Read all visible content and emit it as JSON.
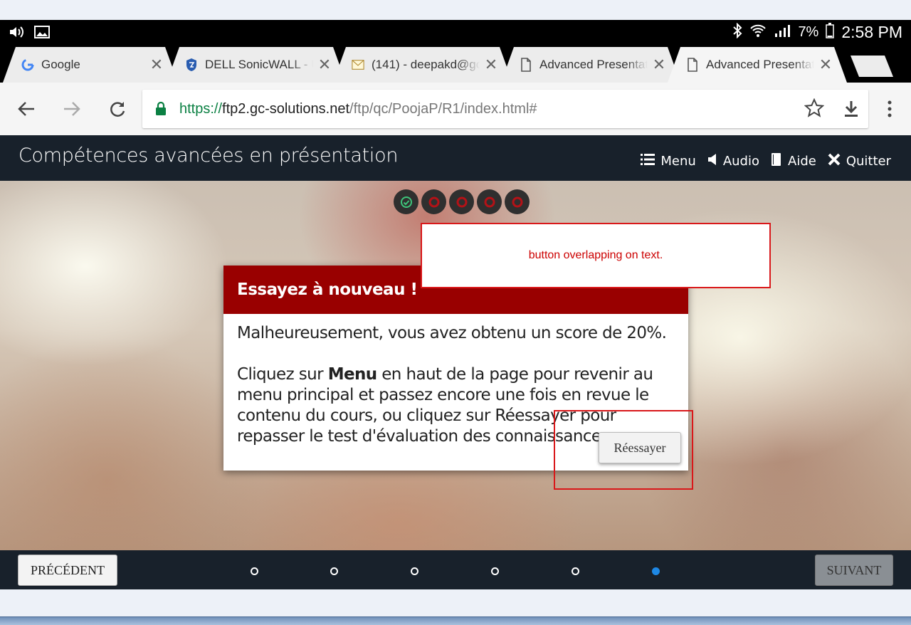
{
  "status_bar": {
    "battery": "7%",
    "time": "2:58 PM"
  },
  "tabs": [
    {
      "title": "Google",
      "icon": "google-g-icon"
    },
    {
      "title": "DELL SonicWALL - U",
      "icon": "shield-icon"
    },
    {
      "title": "(141) - deepakd@gc",
      "icon": "mail-icon"
    },
    {
      "title": "Advanced Presentat",
      "icon": "page-icon"
    },
    {
      "title": "Advanced Presentat",
      "icon": "page-icon"
    }
  ],
  "omnibox": {
    "scheme": "https://",
    "host": "ftp2.gc-solutions.net",
    "path": "/ftp/qc/PoojaP/R1/index.html#"
  },
  "app": {
    "title": "Compétences avancées en présentation",
    "nav": {
      "menu": "Menu",
      "audio": "Audio",
      "help": "Aide",
      "quit": "Quitter"
    }
  },
  "progress": [
    "done",
    "failed",
    "failed",
    "failed",
    "failed"
  ],
  "annotation": {
    "note": "button overlapping on text."
  },
  "dialog": {
    "title": "Essayez à nouveau !",
    "para1": "Malheureusement, vous avez obtenu un score de 20%.",
    "para2_before": "Cliquez sur ",
    "para2_bold": "Menu",
    "para2_after": " en haut de la page pour revenir au menu principal et passez encore une fois en revue le contenu du cours, ou cliquez sur Réessayer pour repasser le test d'évaluation des connaissances.",
    "retry_label": "Réessayer"
  },
  "footer": {
    "prev_label": "PRÉCÉDENT",
    "next_label": "SUIVANT",
    "page_count": 6,
    "current_page": 6
  },
  "colors": {
    "header_bg": "#18212b",
    "dialog_header": "#990000",
    "annotation": "#d9181a",
    "active_dot": "#1e88e5"
  }
}
